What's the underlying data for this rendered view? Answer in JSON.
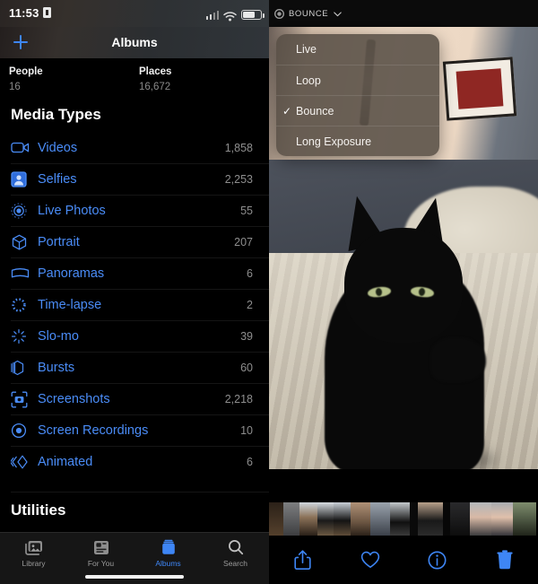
{
  "status_bar": {
    "time": "11:53",
    "badge_icon": "app-badge-icon",
    "signal_icon": "cellular-signal-icon",
    "wifi_icon": "wifi-icon",
    "battery_icon": "battery-icon"
  },
  "nav": {
    "add_icon": "plus-icon",
    "title": "Albums"
  },
  "people_places": [
    {
      "name": "People",
      "count": "16"
    },
    {
      "name": "Places",
      "count": "16,672"
    }
  ],
  "media_types": {
    "heading": "Media Types",
    "items": [
      {
        "icon": "video-camera-icon",
        "label": "Videos",
        "count": "1,858"
      },
      {
        "icon": "selfie-portrait-icon",
        "label": "Selfies",
        "count": "2,253"
      },
      {
        "icon": "live-photo-icon",
        "label": "Live Photos",
        "count": "55"
      },
      {
        "icon": "cube-portrait-icon",
        "label": "Portrait",
        "count": "207"
      },
      {
        "icon": "panorama-icon",
        "label": "Panoramas",
        "count": "6"
      },
      {
        "icon": "timelapse-icon",
        "label": "Time-lapse",
        "count": "2"
      },
      {
        "icon": "slomo-icon",
        "label": "Slo-mo",
        "count": "39"
      },
      {
        "icon": "bursts-icon",
        "label": "Bursts",
        "count": "60"
      },
      {
        "icon": "screenshot-icon",
        "label": "Screenshots",
        "count": "2,218"
      },
      {
        "icon": "screen-recording-icon",
        "label": "Screen Recordings",
        "count": "10"
      },
      {
        "icon": "animated-icon",
        "label": "Animated",
        "count": "6"
      }
    ],
    "chevron_icon": "chevron-right-icon"
  },
  "utilities": {
    "heading": "Utilities"
  },
  "tab_bar": {
    "tabs": [
      {
        "icon": "photo-library-icon",
        "label": "Library",
        "active": false
      },
      {
        "icon": "for-you-icon",
        "label": "For You",
        "active": false
      },
      {
        "icon": "albums-icon",
        "label": "Albums",
        "active": true
      },
      {
        "icon": "search-icon",
        "label": "Search",
        "active": false
      }
    ],
    "home_indicator": "home-indicator"
  },
  "viewer": {
    "live_badge": {
      "icon": "live-photo-icon",
      "label": "BOUNCE",
      "chevron_icon": "chevron-down-icon"
    },
    "effects_menu": {
      "items": [
        {
          "label": "Live",
          "checked": false
        },
        {
          "label": "Loop",
          "checked": false
        },
        {
          "label": "Bounce",
          "checked": true
        },
        {
          "label": "Long Exposure",
          "checked": false
        }
      ],
      "check_glyph": "✓"
    },
    "photo_alt": "black-cat-on-bed-photo",
    "thumbnail_strip": "photo-thumbnail-strip",
    "toolbar": [
      {
        "icon": "share-icon",
        "name": "share-button"
      },
      {
        "icon": "heart-icon",
        "name": "favorite-button"
      },
      {
        "icon": "info-icon",
        "name": "info-button"
      },
      {
        "icon": "trash-icon",
        "name": "delete-button"
      }
    ]
  },
  "colors": {
    "accent_blue": "#4a8cf7",
    "tab_active": "#3e86f5",
    "count_gray": "#8e8e8e",
    "background": "#000000",
    "menu_bg": "rgba(88,78,70,.88)"
  }
}
